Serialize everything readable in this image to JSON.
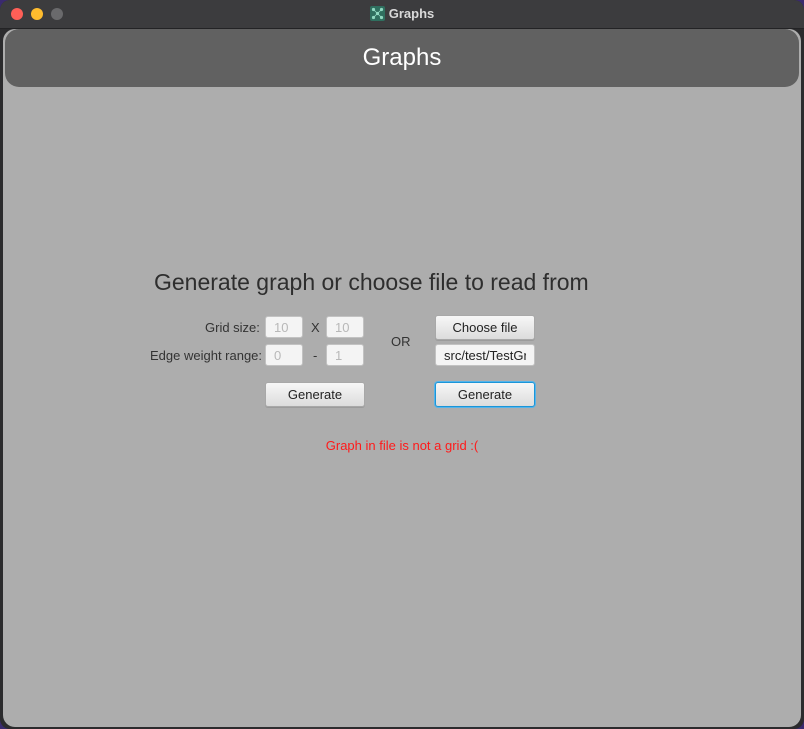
{
  "window": {
    "title": "Graphs",
    "icon": "graph-app-icon"
  },
  "header": {
    "title": "Graphs"
  },
  "main": {
    "heading": "Generate graph or choose file to read from",
    "grid_size": {
      "label": "Grid size:",
      "width_placeholder": "10",
      "separator": "X",
      "height_placeholder": "10"
    },
    "edge_weight": {
      "label": "Edge weight range:",
      "min_placeholder": "0",
      "separator": "-",
      "max_placeholder": "1"
    },
    "or_label": "OR",
    "left_generate_label": "Generate",
    "choose_file_label": "Choose file",
    "file_path_value": "src/test/TestGra",
    "right_generate_label": "Generate",
    "error_message": "Graph in file is not a grid :("
  },
  "colors": {
    "error": "#ff1a1a",
    "focus": "#1b95d8",
    "header": "#616161",
    "background": "#adadad"
  }
}
